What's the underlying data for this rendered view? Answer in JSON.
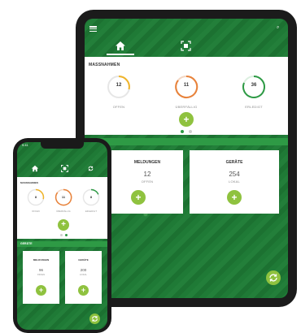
{
  "colors": {
    "primary": "#2e9a45",
    "accent": "#8fc23f",
    "ring_open": "#f0b429",
    "ring_overdue": "#e8823a",
    "ring_done": "#2e9a45"
  },
  "tablet": {
    "title": "MASSNAHMEN",
    "stats": [
      {
        "value": "12",
        "label": "OFFEN"
      },
      {
        "value": "11",
        "label": "ÜBERFÄLLIG"
      },
      {
        "value": "36",
        "label": "ERLEDIGT"
      }
    ],
    "add_label": "+",
    "cards": [
      {
        "title": "MELDUNGEN",
        "value": "12",
        "label": "OFFEN",
        "add_label": "+"
      },
      {
        "title": "GERÄTE",
        "value": "254",
        "label": "LOKAL",
        "add_label": "+"
      }
    ],
    "icons": {
      "menu": "menu-icon",
      "search": "search-icon",
      "home": "home-icon",
      "sensor": "sensor-icon",
      "sync": "sync-icon"
    }
  },
  "phone": {
    "time": "9:41",
    "title": "MASSNAHMEN",
    "stats": [
      {
        "value": "8",
        "label": "OFFEN"
      },
      {
        "value": "11",
        "label": "ÜBERFÄLLIG"
      },
      {
        "value": "8",
        "label": "ERLEDIGT"
      }
    ],
    "add_label": "+",
    "section": "GERÄTE",
    "cards": [
      {
        "title": "MELDUNGEN",
        "value": "96",
        "label": "OFFEN",
        "add_label": "+"
      },
      {
        "title": "GERÄTE",
        "value": "200",
        "label": "LOKAL",
        "add_label": "+"
      }
    ]
  }
}
